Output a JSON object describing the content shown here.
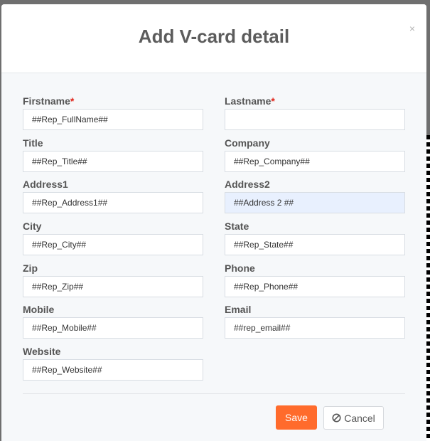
{
  "modal": {
    "title": "Add V-card detail",
    "close_label": "×"
  },
  "fields": {
    "firstname": {
      "label": "Firstname",
      "required_mark": "*",
      "value": "##Rep_FullName##"
    },
    "lastname": {
      "label": "Lastname",
      "required_mark": "*",
      "value": ""
    },
    "title": {
      "label": "Title",
      "value": "##Rep_Title##"
    },
    "company": {
      "label": "Company",
      "value": "##Rep_Company##"
    },
    "address1": {
      "label": "Address1",
      "value": "##Rep_Address1##"
    },
    "address2": {
      "label": "Address2",
      "value": "##Address 2 ##"
    },
    "city": {
      "label": "City",
      "value": "##Rep_City##"
    },
    "state": {
      "label": "State",
      "value": "##Rep_State##"
    },
    "zip": {
      "label": "Zip",
      "value": "##Rep_Zip##"
    },
    "phone": {
      "label": "Phone",
      "value": "##Rep_Phone##"
    },
    "mobile": {
      "label": "Mobile",
      "value": "##Rep_Mobile##"
    },
    "email": {
      "label": "Email",
      "value": "##rep_email##"
    },
    "website": {
      "label": "Website",
      "value": "##Rep_Website##"
    }
  },
  "footer": {
    "save_label": "Save",
    "cancel_label": "Cancel",
    "cancel_icon": "ban-icon"
  },
  "colors": {
    "accent": "#ff6b2c",
    "required": "#e0251b",
    "autofill": "#e8f0fe"
  }
}
